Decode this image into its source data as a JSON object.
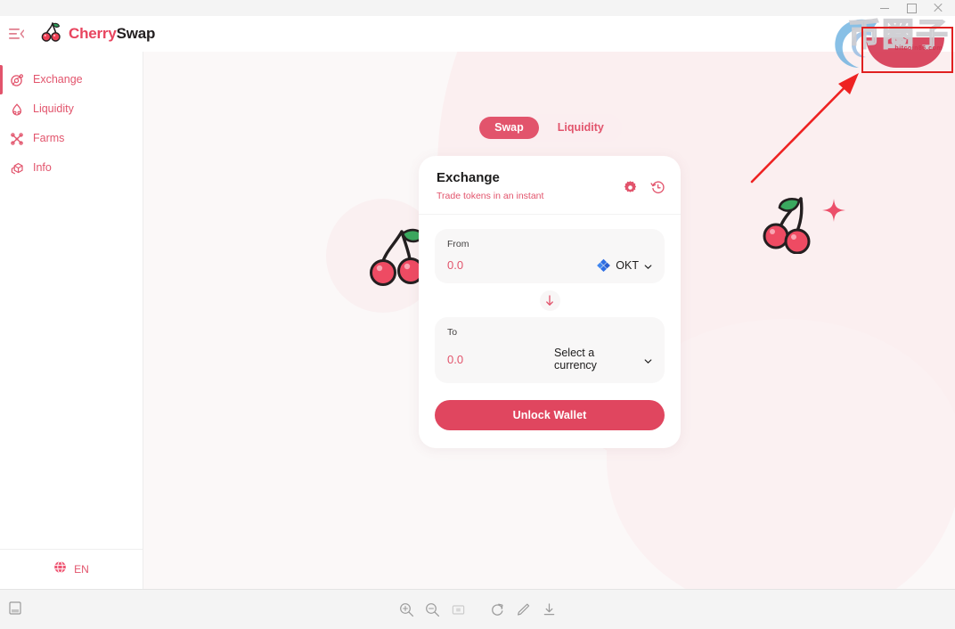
{
  "window": {
    "controls": [
      "minimize",
      "maximize",
      "close"
    ]
  },
  "header": {
    "menu_toggle_icon": "hamburger-collapse-icon",
    "brand_primary": "Cherry",
    "brand_secondary": "Swap",
    "brand_icon": "cherry-logo-icon"
  },
  "sidebar": {
    "items": [
      {
        "label": "Exchange",
        "icon": "aperture-icon",
        "active": true
      },
      {
        "label": "Liquidity",
        "icon": "droplet-icon",
        "active": false
      },
      {
        "label": "Farms",
        "icon": "flower-icon",
        "active": false
      },
      {
        "label": "Info",
        "icon": "cube-icon",
        "active": false
      }
    ],
    "language": {
      "label": "EN",
      "icon": "globe-icon"
    }
  },
  "tabs": [
    {
      "label": "Swap",
      "active": true
    },
    {
      "label": "Liquidity",
      "active": false
    }
  ],
  "card": {
    "title": "Exchange",
    "subtitle": "Trade tokens in an instant",
    "settings_icon": "gear-icon",
    "history_icon": "history-clock-icon",
    "from": {
      "label": "From",
      "amount": "0.0",
      "placeholder": "0.0",
      "token": "OKT",
      "token_icon": "okt-token-icon",
      "chevron": "chevron-down-icon"
    },
    "swap_direction_icon": "arrow-down-icon",
    "to": {
      "label": "To",
      "amount": "0.0",
      "placeholder": "0.0",
      "token": "Select a currency",
      "chevron": "chevron-down-icon"
    },
    "action_button": "Unlock Wallet"
  },
  "decorations": {
    "cherry_left": "cherry-illustration",
    "cherry_right": "cherry-illustration",
    "sparkle": "sparkle-star-icon"
  },
  "watermark": {
    "text": "币圈子",
    "subtext": "bitcoin86.com",
    "swirl_icon": "swirl-logo-icon"
  },
  "annotations": {
    "box": "red-highlight-box",
    "arrow": "red-pointer-arrow"
  },
  "bottom_toolbar": {
    "left_icon": "page-fit-icon",
    "buttons": [
      {
        "icon": "zoom-in-icon"
      },
      {
        "icon": "zoom-out-icon"
      },
      {
        "icon": "actual-size-icon"
      },
      {
        "icon": "rotate-icon"
      },
      {
        "icon": "edit-pencil-icon"
      },
      {
        "icon": "download-icon"
      }
    ]
  },
  "colors": {
    "accent": "#e2546c",
    "accent_strong": "#e0465f",
    "dark": "#1d1c1c",
    "bg": "#fbf8f8",
    "blob": "#fbeff0",
    "annotation_red": "#e02020"
  }
}
